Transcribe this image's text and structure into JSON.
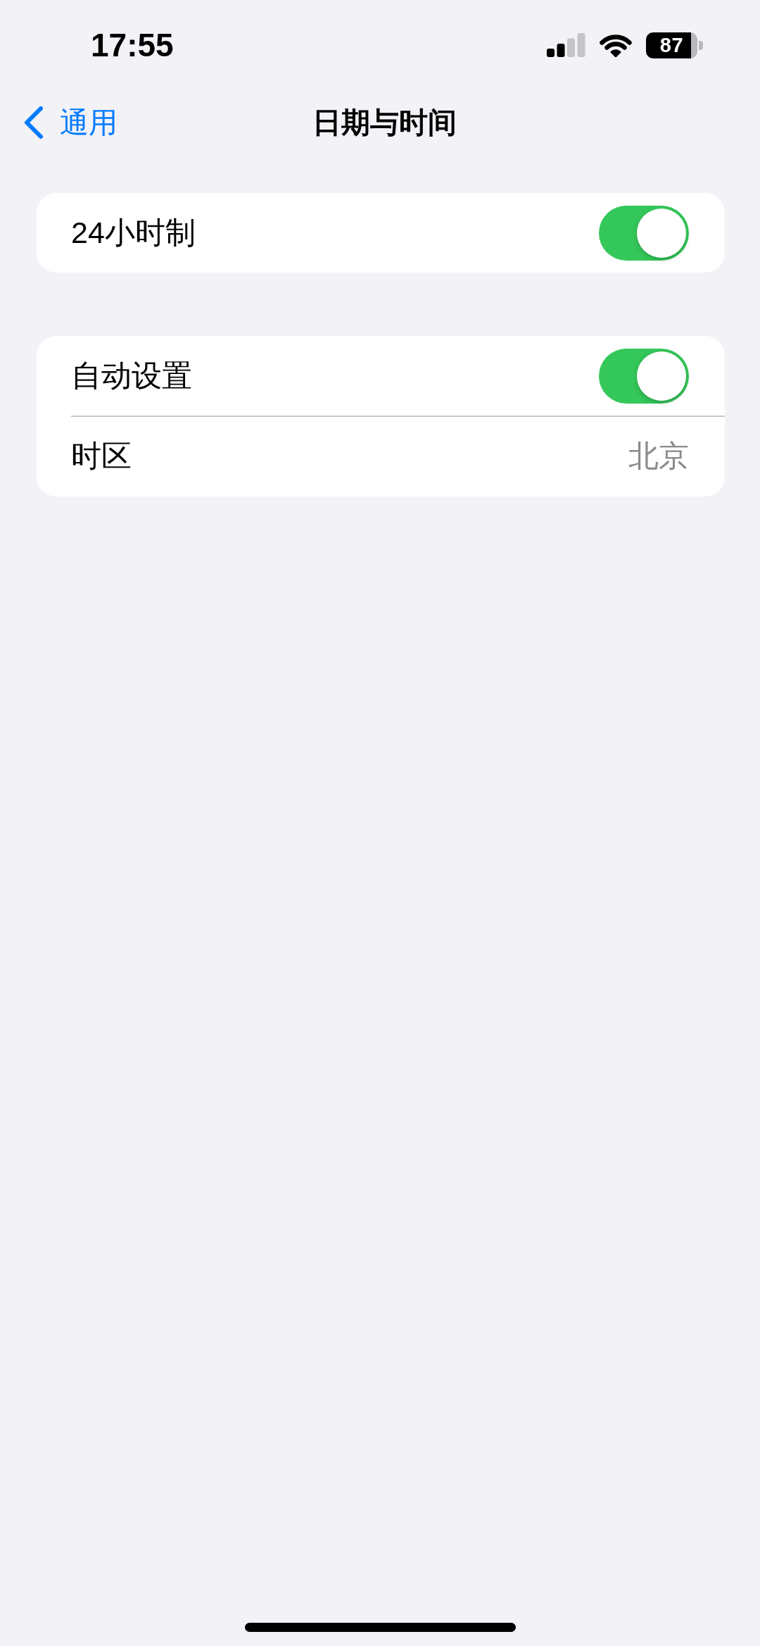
{
  "status_bar": {
    "time": "17:55",
    "battery": "87"
  },
  "nav_bar": {
    "back_label": "通用",
    "title": "日期与时间"
  },
  "groups": [
    {
      "rows": [
        {
          "kind": "toggle",
          "label": "24小时制",
          "on": true
        }
      ]
    },
    {
      "rows": [
        {
          "kind": "toggle",
          "label": "自动设置",
          "on": true
        },
        {
          "kind": "value",
          "label": "时区",
          "value": "北京"
        }
      ]
    }
  ]
}
